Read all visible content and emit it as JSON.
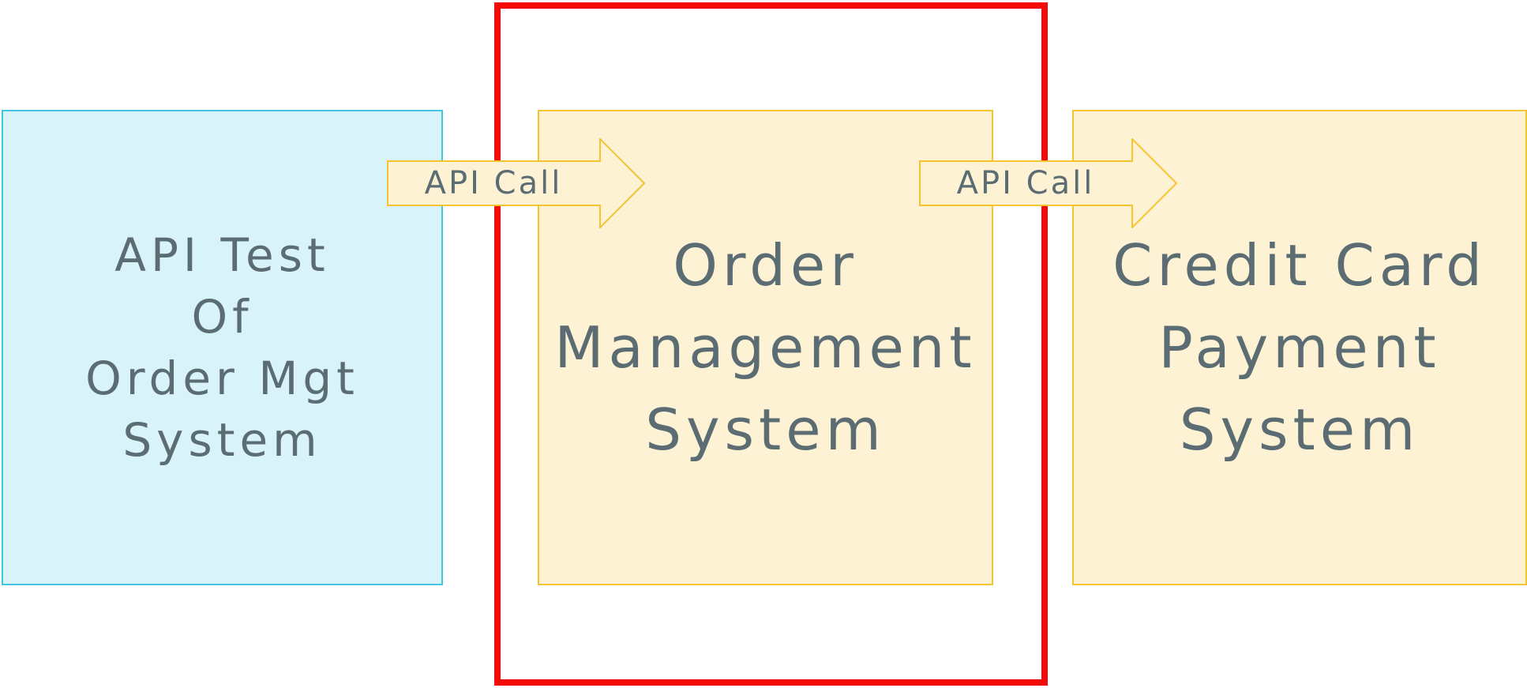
{
  "boxes": {
    "test_client": {
      "label": "API Test\nOf\nOrder Mgt\nSystem",
      "fill": "#d8f3f9",
      "border": "#3ec6e2"
    },
    "order_management": {
      "label": "Order\nManagement\nSystem",
      "fill": "#fdf2d4",
      "border": "#f5c431"
    },
    "credit_card_payment": {
      "label": "Credit Card\nPayment\nSystem",
      "fill": "#fdf2d4",
      "border": "#f5c431"
    }
  },
  "arrows": [
    {
      "label": "API Call"
    },
    {
      "label": "API Call"
    }
  ],
  "highlight": {
    "color": "#f50a0a"
  },
  "text_color": "#5b6c73"
}
